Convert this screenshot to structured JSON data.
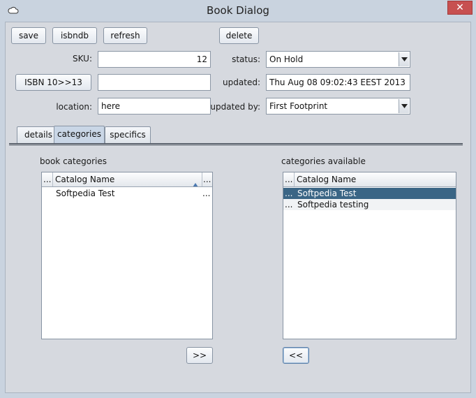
{
  "window": {
    "title": "Book Dialog",
    "close_glyph": "✕",
    "app_icon": "cloud-icon"
  },
  "toolbar": {
    "save": "save",
    "isbndb": "isbndb",
    "refresh": "refresh",
    "delete": "delete"
  },
  "form": {
    "sku_label": "SKU:",
    "sku_value": "12",
    "isbn_button": "ISBN 10>>13",
    "isbn_value": "",
    "location_label": "location:",
    "location_value": "here",
    "status_label": "status:",
    "status_value": "On Hold",
    "updated_label": "updated:",
    "updated_value": "Thu Aug 08 09:02:43 EEST 2013",
    "updated_by_label": "updated by:",
    "updated_by_value": "First Footprint"
  },
  "tabs": [
    {
      "label": "details",
      "active": false
    },
    {
      "label": "categories",
      "active": true
    },
    {
      "label": "specifics",
      "active": false
    }
  ],
  "book_categories": {
    "title": "book categories",
    "columns": [
      "...",
      "Catalog Name",
      "..."
    ],
    "sort_icon": "sort-ascending-icon",
    "rows": [
      {
        "lead": "",
        "name": "Softpedia Test",
        "trail": "..."
      }
    ]
  },
  "categories_available": {
    "title": "categories available",
    "columns": [
      "...",
      "Catalog Name"
    ],
    "rows": [
      {
        "lead": "...",
        "name": "Softpedia Test",
        "selected": true
      },
      {
        "lead": "...",
        "name": "Softpedia testing",
        "selected": false
      }
    ]
  },
  "transfer": {
    "add": ">>",
    "remove": "<<"
  },
  "colors": {
    "selection": "#3a6585",
    "background": "#d6d9df",
    "close": "#c75050"
  }
}
